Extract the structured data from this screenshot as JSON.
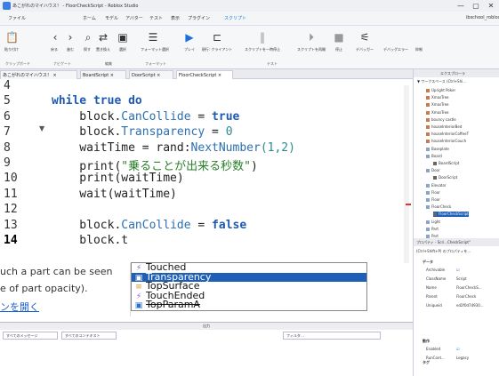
{
  "window": {
    "title": "あこがれのマイハウス！ - FloorCheckScript - Roblox Studio",
    "minimize": "—",
    "maximize": "▢",
    "close": "✕"
  },
  "menubar": {
    "items": [
      "ファイル",
      "ホーム",
      "モデル",
      "アバター",
      "テスト",
      "表示",
      "プラグイン",
      "スクリプト"
    ],
    "account": "ibschool_roblox"
  },
  "ribbon": {
    "buttons": [
      "貼り付け",
      "戻る",
      "進む",
      "探す",
      "置き換え",
      "選択",
      "フォーマット選択",
      "プレイ",
      "現行: クライアント",
      "スクリプトを一時停止",
      "スクリプトを再開",
      "停止",
      "デバッガー",
      "デバッグエラー",
      "抑制"
    ],
    "groups": [
      "クリップボード",
      "ナビゲート",
      "編集",
      "フォーマット",
      "テスト"
    ]
  },
  "tabs": [
    "あこがれのマイハウス！ ×",
    "BoardScript ×",
    "DoorScript ×",
    "FloorCheckScript ×"
  ],
  "editor": {
    "line_numbers": [
      "4",
      "5",
      "6",
      "7",
      "8",
      "9",
      "10",
      "11",
      "12",
      "13",
      "14"
    ],
    "lines": [
      [],
      [
        {
          "t": "while ",
          "c": "kw"
        },
        {
          "t": "true ",
          "c": "kw"
        },
        {
          "t": "do",
          "c": "kw"
        }
      ],
      [
        {
          "t": "    block.",
          "c": "fn"
        },
        {
          "t": "CanCollide",
          "c": "prop"
        },
        {
          "t": " = ",
          "c": "fn"
        },
        {
          "t": "true",
          "c": "kw"
        }
      ],
      [
        {
          "t": "    block.",
          "c": "fn"
        },
        {
          "t": "Transparency",
          "c": "prop"
        },
        {
          "t": " = ",
          "c": "fn"
        },
        {
          "t": "0",
          "c": "num"
        }
      ],
      [
        {
          "t": "    waitTime = rand:",
          "c": "fn"
        },
        {
          "t": "NextNumber",
          "c": "prop"
        },
        {
          "t": "(1,2)",
          "c": "num"
        }
      ],
      [
        {
          "t": "    print(",
          "c": "fn"
        },
        {
          "t": "\"乗ることが出来る秒数\"",
          "c": "str"
        },
        {
          "t": ")",
          "c": "fn"
        }
      ],
      [
        {
          "t": "    print(waitTime)",
          "c": "fn"
        }
      ],
      [
        {
          "t": "    wait(waitTime)",
          "c": "fn"
        }
      ],
      [],
      [
        {
          "t": "    block.",
          "c": "fn"
        },
        {
          "t": "CanCollide",
          "c": "prop"
        },
        {
          "t": " = ",
          "c": "fn"
        },
        {
          "t": "false",
          "c": "kw"
        }
      ],
      [
        {
          "t": "    block.t",
          "c": "fn"
        }
      ]
    ]
  },
  "autocomplete": [
    {
      "icon": "⚡",
      "label": "Touched",
      "color": "#8a4fd8"
    },
    {
      "icon": "▣",
      "label": "Transparency",
      "color": "#fff"
    },
    {
      "icon": "≡",
      "label": "TopSurface",
      "color": "#d89a2a"
    },
    {
      "icon": "⚡",
      "label": "TouchEnded",
      "color": "#8a4fd8"
    },
    {
      "icon": "▣",
      "label": "TopParamA",
      "color": "#2c72c9"
    }
  ],
  "tooltip": {
    "line1": "uch a part can be seen",
    "line2": "e of part opacity).",
    "link": "ンを開く"
  },
  "output": {
    "title": "出力",
    "filter1": "すべてのメッセージ",
    "filter2": "すべてのコンテキスト",
    "filter_box": "フィルタ..."
  },
  "explorer": {
    "title": "エクスプローラ",
    "search": "▼ ワークスペース (Ctrl+Shi...",
    "items": [
      "Upright Poker",
      "XmasTree",
      "XmasTree",
      "XmasTree",
      "bouncy castle",
      "houseInteriorBed",
      "houseInteriorCoffeeT",
      "houseInteriorCouch",
      "Baseplate",
      "Board",
      "BoardScript",
      "Door",
      "DoorScript",
      "Elevator",
      "Floor",
      "Floor",
      "FloorCheck",
      "FloorCheckScript",
      "Light",
      "Part",
      "Part"
    ]
  },
  "properties": {
    "title": "プロパティ - Scri...CheckScript\"",
    "filter": "(Ctrl+Shift+P) のプロパティを...",
    "section_data": "データ",
    "rows": [
      [
        "Archivable",
        "☑"
      ],
      [
        "ClassName",
        "Script"
      ],
      [
        "Name",
        "FloorCheckS..."
      ],
      [
        "Parent",
        "FloorCheck"
      ],
      [
        "Uniqueid",
        "ed2f0d7d930..."
      ]
    ],
    "section_behavior": "動作",
    "rows2": [
      [
        "Enabled",
        "☑"
      ],
      [
        "RunCont...",
        "Legacy"
      ]
    ],
    "section_tag": "タグ"
  }
}
